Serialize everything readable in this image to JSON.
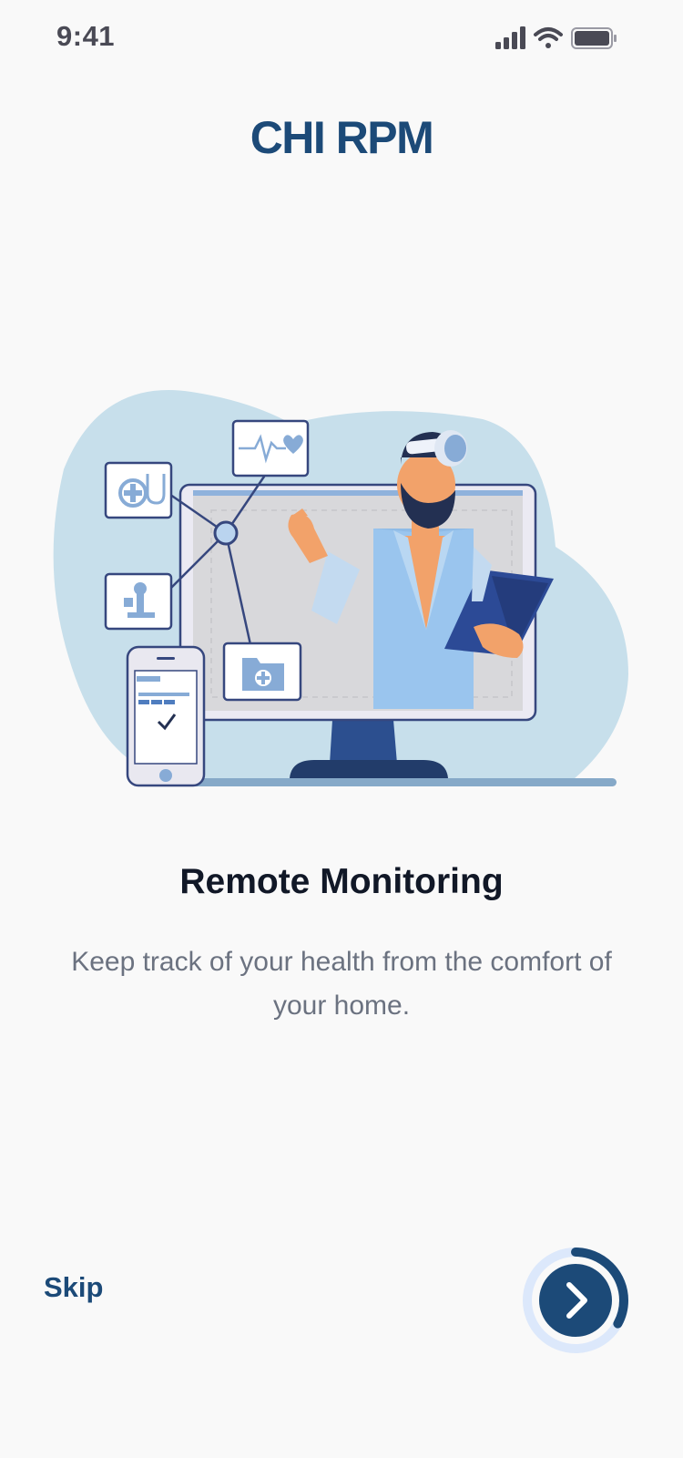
{
  "status_bar": {
    "time": "9:41",
    "icons": [
      "cellular-signal-icon",
      "wifi-icon",
      "battery-icon"
    ]
  },
  "app": {
    "title": "CHI RPM"
  },
  "onboarding": {
    "illustration": "doctor-telehealth-illustration",
    "title": "Remote Monitoring",
    "description": "Keep track of your health from the comfort of your home.",
    "skip_label": "Skip",
    "next_icon": "chevron-right-icon",
    "progress": 0.33
  },
  "colors": {
    "primary": "#1c4a78",
    "ring_track": "#dce8fb",
    "background": "#f9f9f9",
    "title_text": "#111827",
    "body_text": "#6b7280"
  }
}
